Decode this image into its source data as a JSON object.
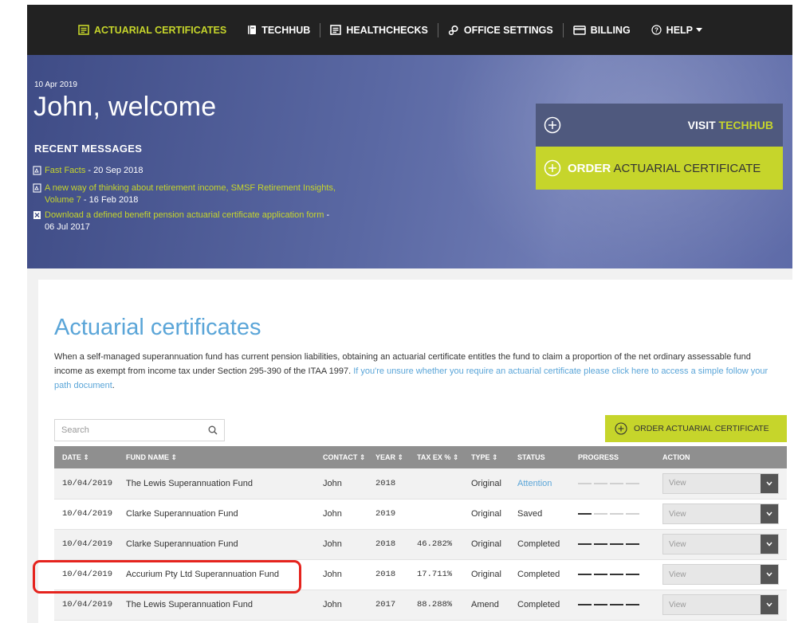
{
  "nav": {
    "items": [
      {
        "label": "ACTUARIAL CERTIFICATES",
        "icon": "document-icon",
        "active": true
      },
      {
        "label": "TECHHUB",
        "icon": "book-icon"
      },
      {
        "label": "HEALTHCHECKS",
        "icon": "document-icon"
      },
      {
        "label": "OFFICE SETTINGS",
        "icon": "gears-icon"
      },
      {
        "label": "BILLING",
        "icon": "credit-card-icon"
      },
      {
        "label": "HELP",
        "icon": "help-circle-icon"
      }
    ]
  },
  "hero": {
    "date": "10 Apr 2019",
    "title": "John, welcome",
    "recent_heading": "RECENT MESSAGES",
    "messages": [
      {
        "link": "Fast Facts",
        "date": " - 20 Sep 2018"
      },
      {
        "link": "A new way of thinking about retirement income, SMSF Retirement Insights, Volume 7",
        "date": " - 16 Feb 2018"
      },
      {
        "link": "Download a defined benefit pension actuarial certificate application form",
        "date": " - 06 Jul 2017"
      }
    ],
    "visit_prefix": "VISIT ",
    "visit_highlight": "TECHHUB",
    "order_prefix": "ORDER",
    "order_rest": " ACTUARIAL CERTIFICATE"
  },
  "section": {
    "title": "Actuarial certificates",
    "desc": "When a self-managed superannuation fund has current pension liabilities, obtaining an actuarial certificate entitles the fund to claim a proportion of the net ordinary assessable fund income as exempt from income tax under Section 295-390 of the ITAA 1997. ",
    "desc_link": "If you're unsure whether you require an actuarial certificate please click here to access a simple follow your path document",
    "desc_end": ".",
    "search_placeholder": "Search",
    "order_button": "ORDER ACTUARIAL CERTIFICATE"
  },
  "table": {
    "headers": {
      "date": "DATE ⇕",
      "fund": "FUND NAME ⇕",
      "contact": "CONTACT ⇕",
      "year": "YEAR ⇕",
      "tax": "TAX EX % ⇕",
      "type": "TYPE ⇕",
      "status": "STATUS",
      "progress": "PROGRESS",
      "action": "ACTION"
    },
    "action_label": "View",
    "rows": [
      {
        "date": "10/04/2019",
        "fund": "The Lewis Superannuation Fund",
        "contact": "John",
        "year": "2018",
        "tax": "",
        "type": "Original",
        "status": "Attention",
        "progress": 0
      },
      {
        "date": "10/04/2019",
        "fund": "Clarke Superannuation Fund",
        "contact": "John",
        "year": "2019",
        "tax": "",
        "type": "Original",
        "status": "Saved",
        "progress": 1
      },
      {
        "date": "10/04/2019",
        "fund": "Clarke Superannuation Fund",
        "contact": "John",
        "year": "2018",
        "tax": "46.282%",
        "type": "Original",
        "status": "Completed",
        "progress": 4
      },
      {
        "date": "10/04/2019",
        "fund": "Accurium Pty Ltd Superannuation Fund",
        "contact": "John",
        "year": "2018",
        "tax": "17.711%",
        "type": "Original",
        "status": "Completed",
        "progress": 4
      },
      {
        "date": "10/04/2019",
        "fund": "The Lewis Superannuation Fund",
        "contact": "John",
        "year": "2017",
        "tax": "88.288%",
        "type": "Amend",
        "status": "Completed",
        "progress": 4
      }
    ]
  },
  "colors": {
    "accent": "#c6d52b",
    "link_blue": "#5aa5d8",
    "nav_bg": "#222222",
    "highlight_red": "#e5231d"
  }
}
